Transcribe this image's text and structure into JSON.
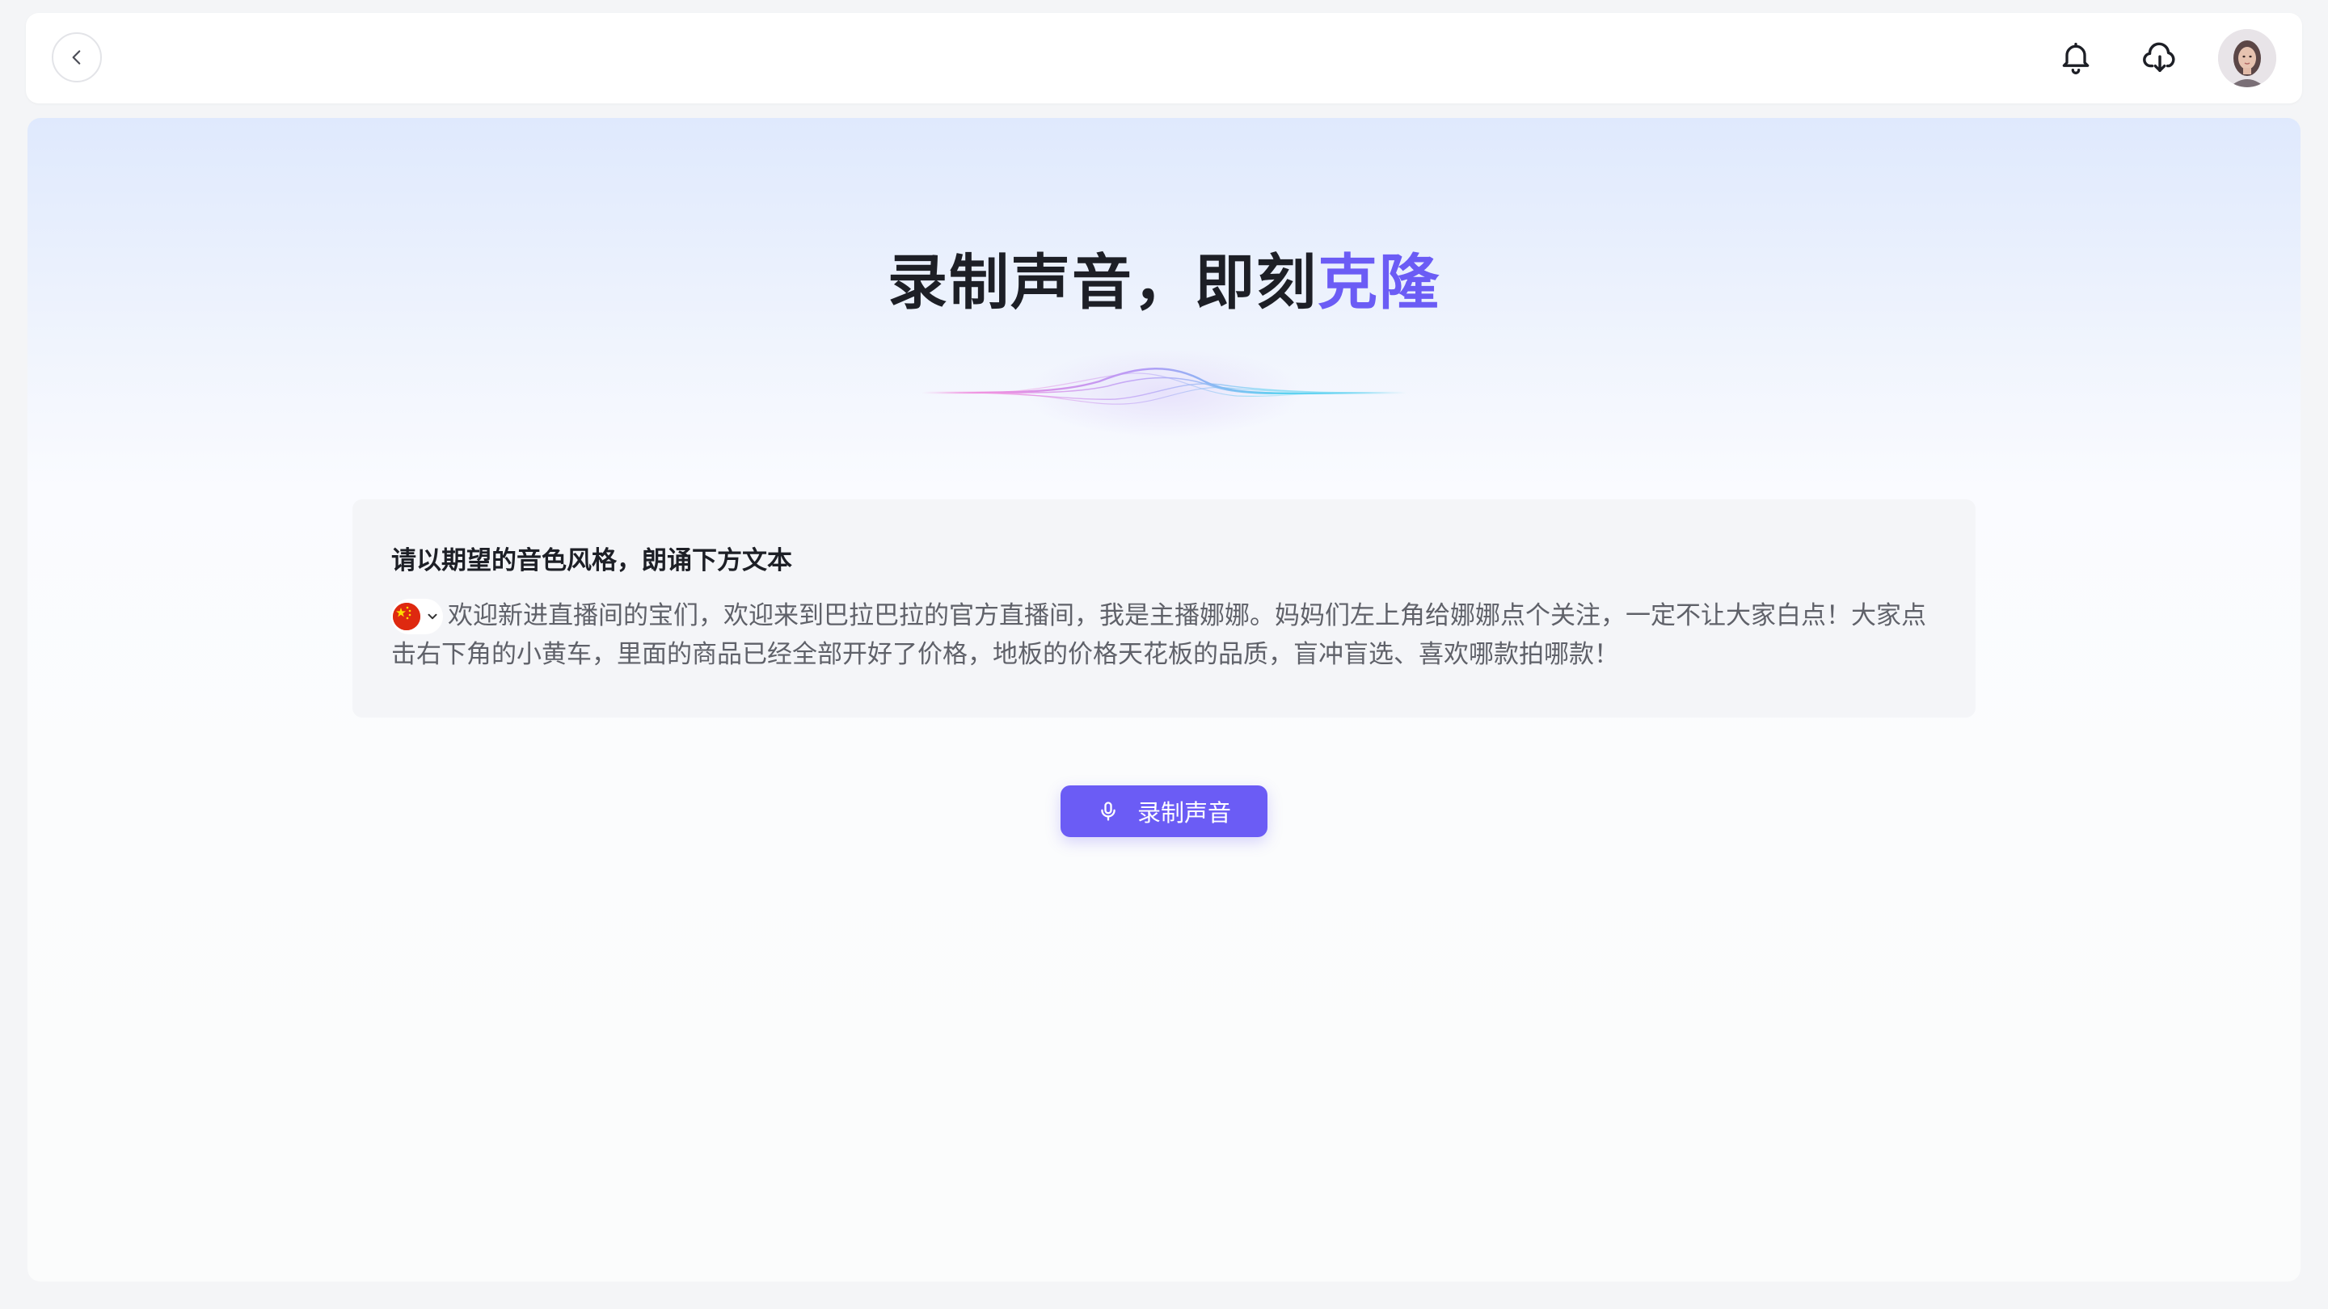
{
  "header": {
    "back_icon": "chevron-left-icon",
    "notification_icon": "bell-icon",
    "download_icon": "cloud-download-icon",
    "avatar_icon": "user-avatar"
  },
  "hero": {
    "title_main": "录制声音，即刻",
    "title_accent": "克隆",
    "accent_color": "#6b5cf5"
  },
  "script_card": {
    "title": "请以期望的音色风格，朗诵下方文本",
    "language_flag": "china-flag-icon",
    "text": "欢迎新进直播间的宝们，欢迎来到巴拉巴拉的官方直播间，我是主播娜娜。妈妈们左上角给娜娜点个关注，一定不让大家白点！大家点击右下角的小黄车，里面的商品已经全部开好了价格，地板的价格天花板的品质，盲冲盲选、喜欢哪款拍哪款！"
  },
  "actions": {
    "record_label": "录制声音",
    "record_icon": "microphone-icon",
    "button_color": "#6b5cf5"
  }
}
